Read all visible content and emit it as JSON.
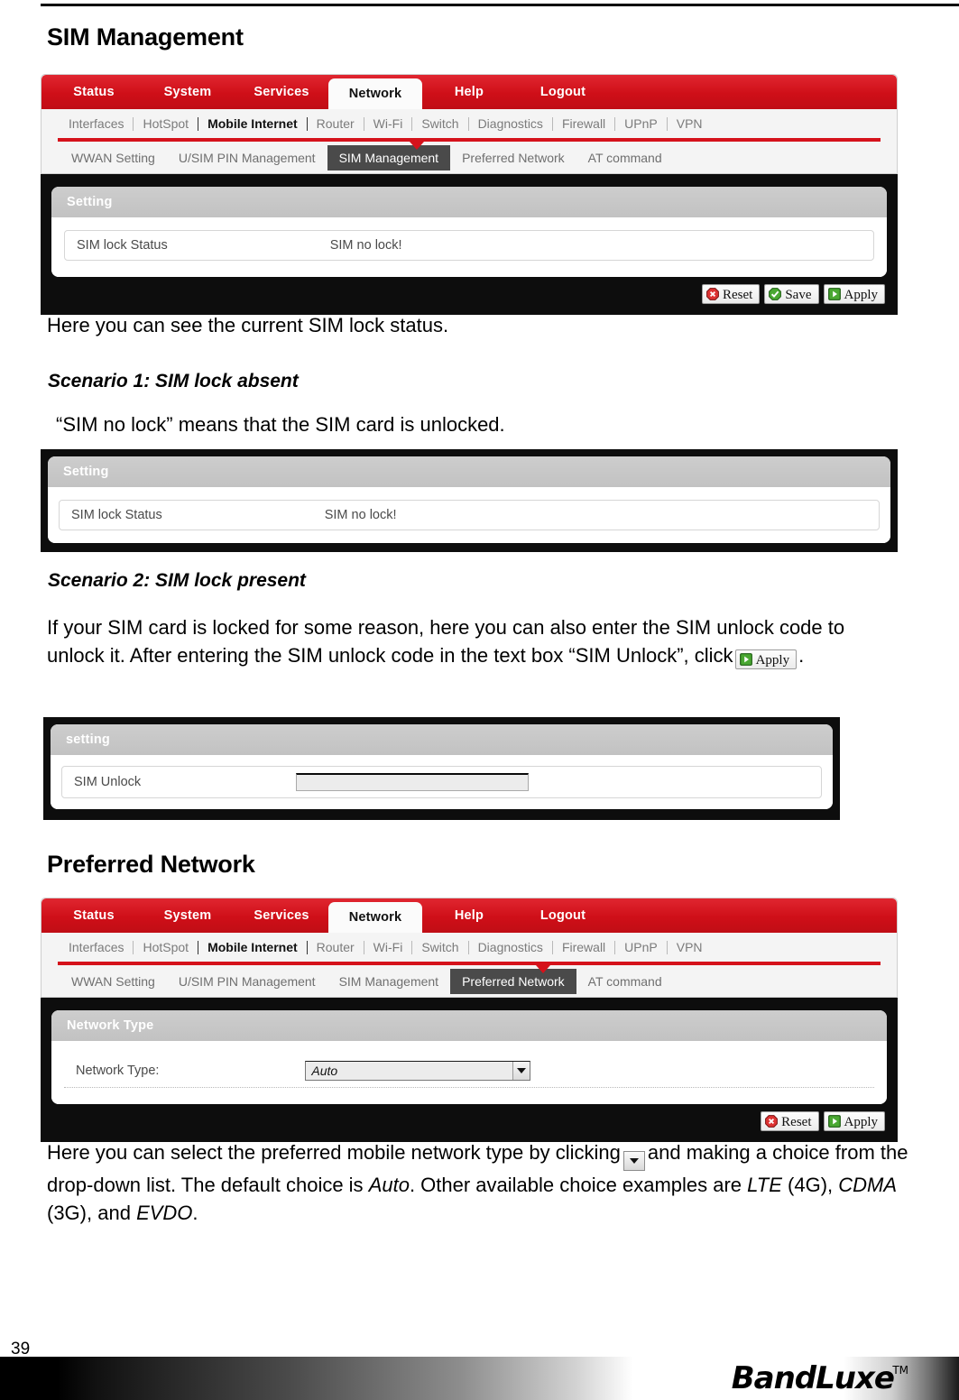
{
  "document": {
    "page_number": "39",
    "brand": "BandLuxe",
    "brand_tm": "TM"
  },
  "sections": {
    "sim_management": {
      "heading": "SIM Management",
      "caption": "Here you can see the current SIM lock status.",
      "scenario1": {
        "heading": "Scenario 1: SIM lock absent",
        "text": "“SIM no lock” means that the SIM card is unlocked."
      },
      "scenario2": {
        "heading": "Scenario 2: SIM lock present",
        "text_before": "If your SIM card is locked for some reason, here you can also enter the SIM unlock code to unlock it. After entering the SIM unlock code in the text box “SIM Unlock”, click",
        "text_after": "."
      }
    },
    "preferred_network": {
      "heading": "Preferred Network",
      "text_a": "Here you can select the preferred mobile network type by clicking",
      "text_b": "and making a choice from the drop-down list. The default choice is",
      "default_choice": "Auto",
      "text_c": ". Other available choice examples are",
      "opt_lte": "LTE",
      "opt_lte_gen": "(4G),",
      "opt_cdma": "CDMA",
      "opt_cdma_gen": "(3G), and",
      "opt_evdo": "EVDO",
      "text_d": "."
    }
  },
  "router_ui": {
    "main_nav": [
      {
        "label": "Status",
        "active": false
      },
      {
        "label": "System",
        "active": false
      },
      {
        "label": "Services",
        "active": false
      },
      {
        "label": "Network",
        "active": true
      },
      {
        "label": "Help",
        "active": false
      },
      {
        "label": "Logout",
        "active": false
      }
    ],
    "sub_nav": [
      {
        "label": "Interfaces",
        "bold": false
      },
      {
        "label": "HotSpot",
        "bold": false
      },
      {
        "label": "Mobile Internet",
        "bold": true
      },
      {
        "label": "Router",
        "bold": false
      },
      {
        "label": "Wi-Fi",
        "bold": false
      },
      {
        "label": "Switch",
        "bold": false
      },
      {
        "label": "Diagnostics",
        "bold": false
      },
      {
        "label": "Firewall",
        "bold": false
      },
      {
        "label": "UPnP",
        "bold": false
      },
      {
        "label": "VPN",
        "bold": false
      }
    ],
    "tab_nav": [
      {
        "label": "WWAN Setting"
      },
      {
        "label": "U/SIM PIN Management"
      },
      {
        "label": "SIM Management"
      },
      {
        "label": "Preferred Network"
      },
      {
        "label": "AT command"
      }
    ],
    "active_tab_sim": "SIM Management",
    "active_tab_pref": "Preferred Network",
    "buttons": {
      "reset": "Reset",
      "save": "Save",
      "apply": "Apply"
    },
    "colors": {
      "nav_red": "#d5121b",
      "active_tab_gray": "#4a4a4a",
      "panel_header_gray": "#c9c9c9",
      "frame_black": "#0d0d0d"
    }
  },
  "screenshot_1": {
    "panel_title": "Setting",
    "row_label": "SIM lock Status",
    "row_value": "SIM no lock!"
  },
  "screenshot_2": {
    "panel_title": "Setting",
    "row_label": "SIM lock Status",
    "row_value": "SIM no lock!"
  },
  "screenshot_3": {
    "panel_title": "setting",
    "row_label": "SIM Unlock",
    "input_value": ""
  },
  "screenshot_4": {
    "panel_title": "Network Type",
    "row_label": "Network Type:",
    "select_value": "Auto"
  }
}
